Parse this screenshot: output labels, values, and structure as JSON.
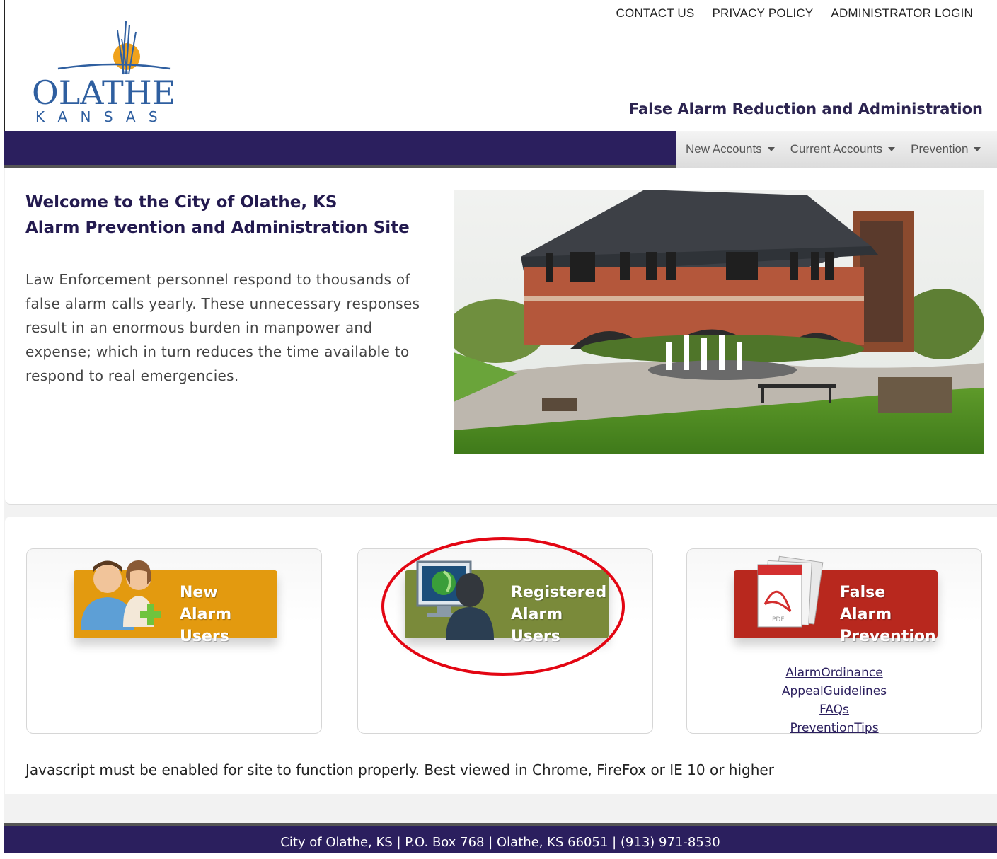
{
  "header": {
    "top_links": [
      "CONTACT US",
      "PRIVACY POLICY",
      "ADMINISTRATOR LOGIN"
    ],
    "logo_word": "OLATHE",
    "logo_sub": "K A N S A S",
    "site_title": "False Alarm Reduction and Administration"
  },
  "nav": {
    "items": [
      "New Accounts",
      "Current Accounts",
      "Prevention"
    ]
  },
  "welcome": {
    "title_line1": "Welcome to the City of Olathe, KS",
    "title_line2": "Alarm Prevention and Administration Site",
    "body": "Law Enforcement personnel respond to thousands of false alarm calls yearly. These unnecessary responses result in an enormous burden in manpower and expense; which in turn reduces the time available to respond to real emergencies."
  },
  "cards": {
    "new_line1": "New",
    "new_line2": "Alarm Users",
    "registered_line1": "Registered",
    "registered_line2": "Alarm Users",
    "prevention_line1": "False Alarm",
    "prevention_line2": "Prevention",
    "pdf_label": "PDF",
    "prevention_links": [
      "AlarmOrdinance",
      "AppealGuidelines",
      "FAQs",
      "PreventionTips"
    ]
  },
  "notice": "Javascript must be enabled for site to function properly. Best viewed in Chrome, FireFox or IE 10 or higher",
  "footer": "City of Olathe, KS | P.O. Box 768 | Olathe, KS 66051 | (913) 971-8530",
  "colors": {
    "nav_purple": "#2b1f5e",
    "new_orange": "#e39a0f",
    "registered_green": "#7a8a3a",
    "prevention_red": "#b8281e",
    "highlight_red": "#e30613"
  }
}
